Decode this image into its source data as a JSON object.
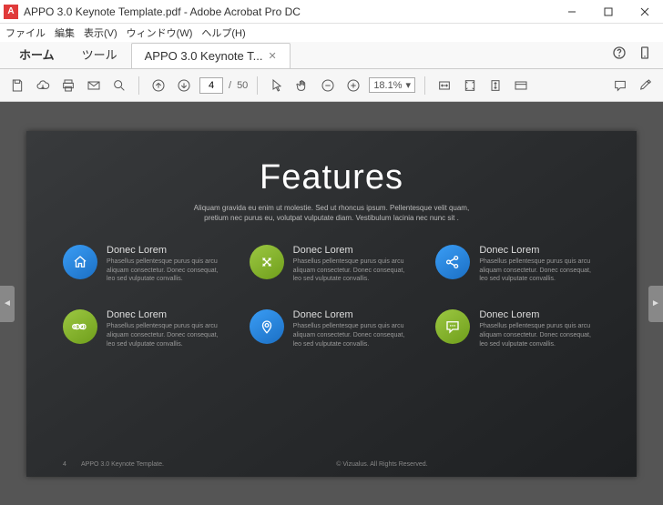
{
  "window": {
    "title": "APPO 3.0 Keynote Template.pdf - Adobe Acrobat Pro DC"
  },
  "menu": {
    "file": "ファイル",
    "edit": "編集",
    "view": "表示(V)",
    "window": "ウィンドウ(W)",
    "help": "ヘルプ(H)"
  },
  "tabs": {
    "home": "ホーム",
    "tools": "ツール",
    "doc": "APPO 3.0 Keynote T..."
  },
  "toolbar": {
    "page_current": "4",
    "page_sep": "/",
    "page_total": "50",
    "zoom": "18.1%"
  },
  "slide": {
    "heading": "Features",
    "subtitle_line1": "Aliquam gravida eu enim ut molestie. Sed ut rhoncus ipsum. Pellentesque velit quam,",
    "subtitle_line2": "pretium nec purus eu, volutpat vulputate diam. Vestibulum lacinia nec nunc sit .",
    "features": [
      {
        "title": "Donec Lorem",
        "desc": "Phasellus pellentesque purus quis arcu aliquam consectetur. Donec consequat, leo sed vulputate convallis."
      },
      {
        "title": "Donec Lorem",
        "desc": "Phasellus pellentesque purus quis arcu aliquam consectetur. Donec consequat, leo sed vulputate convallis."
      },
      {
        "title": "Donec Lorem",
        "desc": "Phasellus pellentesque purus quis arcu aliquam consectetur. Donec consequat, leo sed vulputate convallis."
      },
      {
        "title": "Donec Lorem",
        "desc": "Phasellus pellentesque purus quis arcu aliquam consectetur. Donec consequat, leo sed vulputate convallis."
      },
      {
        "title": "Donec Lorem",
        "desc": "Phasellus pellentesque purus quis arcu aliquam consectetur. Donec consequat, leo sed vulputate convallis."
      },
      {
        "title": "Donec Lorem",
        "desc": "Phasellus pellentesque purus quis arcu aliquam consectetur. Donec consequat, leo sed vulputate convallis."
      }
    ],
    "footer": {
      "page": "4",
      "template": "APPO 3.0 Keynote Template.",
      "copyright": "© Vizualus. All Rights Reserved."
    }
  }
}
